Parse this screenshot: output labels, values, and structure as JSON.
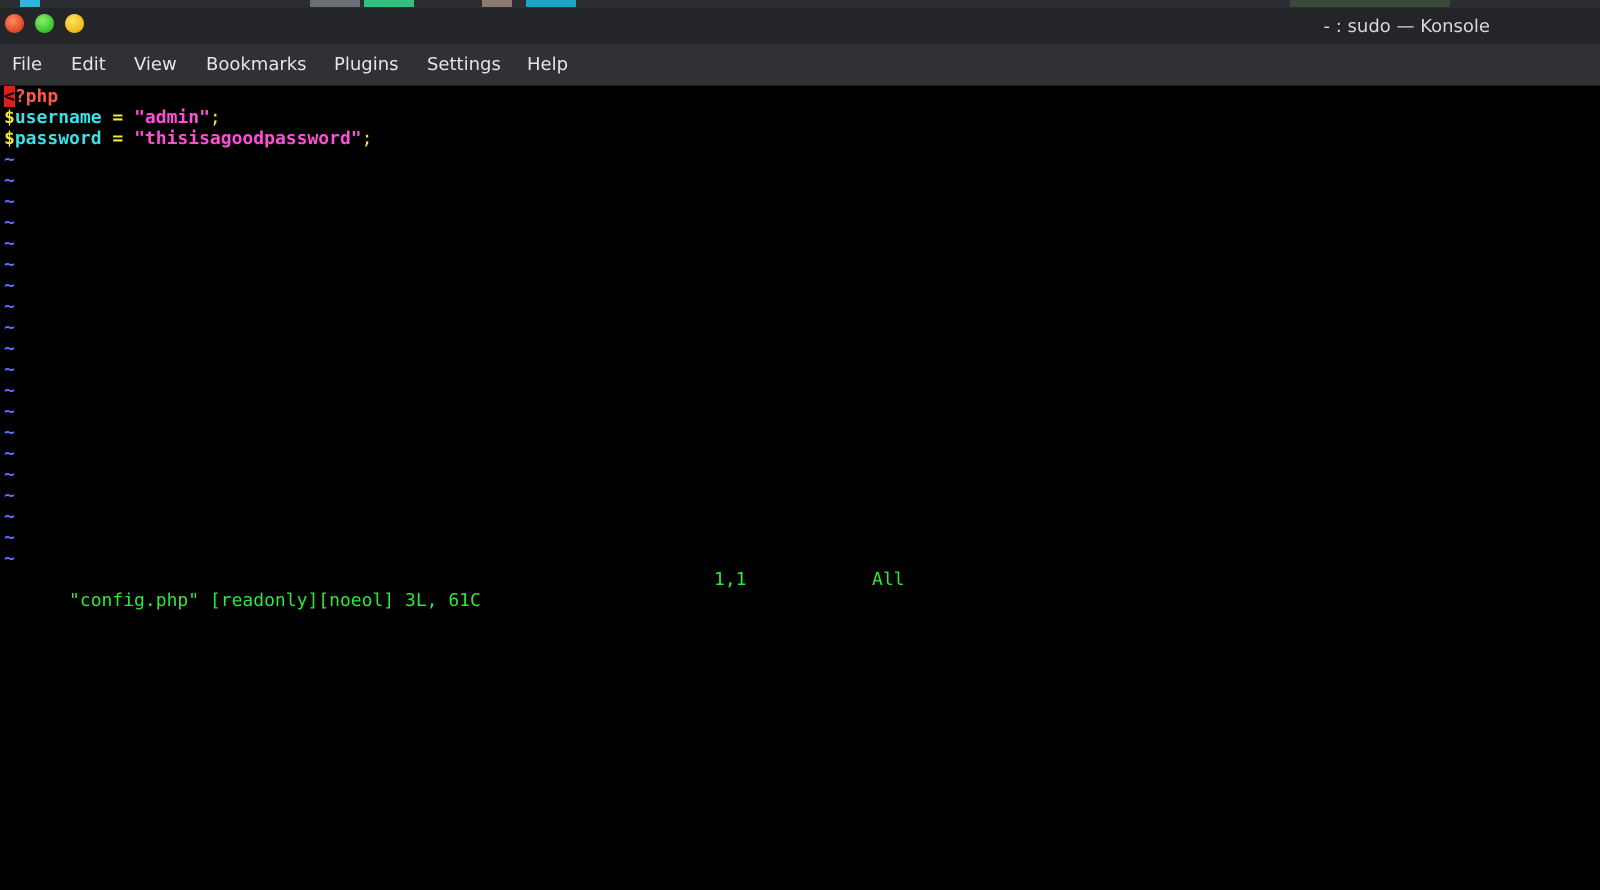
{
  "window": {
    "title": "- : sudo — Konsole"
  },
  "menubar": {
    "items": [
      "File",
      "Edit",
      "View",
      "Bookmarks",
      "Plugins",
      "Settings",
      "Help"
    ]
  },
  "editor": {
    "lines": [
      {
        "cursor": "<",
        "tag": "?php"
      },
      {
        "sigil": "$",
        "name": "username",
        "op": " = ",
        "value": "\"admin\"",
        "end": ";"
      },
      {
        "sigil": "$",
        "name": "password",
        "op": " = ",
        "value": "\"thisisagoodpassword\"",
        "end": ";"
      }
    ],
    "empty_marker": "~",
    "empty_line_count": 20
  },
  "statusline": {
    "file_info": "\"config.php\" [readonly][noeol] 3L, 61C",
    "position": "1,1",
    "scroll": "All"
  },
  "colors": {
    "cursor": "#e01e1e",
    "php_tag": "#ff5a4e",
    "variable_sigil": "#f5e63c",
    "variable_name": "#3ee0e8",
    "string": "#ff4fd8",
    "tilde": "#5b6dff",
    "status_text": "#2ee83a"
  }
}
